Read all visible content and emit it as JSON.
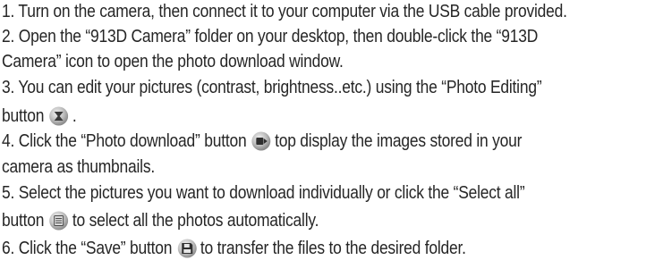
{
  "instructions": {
    "step1": "1. Turn on the camera, then connect it to your computer via the USB cable provided.",
    "step2_line1": "2. Open the “913D Camera” folder on your desktop, then double-click the “913D",
    "step2_line2": "Camera” icon to open the photo download window.",
    "step3_line1": "3. You can edit your pictures (contrast, brightness..etc.) using the “Photo Editing”",
    "step3_line2_before": "button",
    "step3_line2_after": ".",
    "step4_line1_before": "4. Click the “Photo download” button",
    "step4_line1_after": "top display the images stored in your",
    "step4_line2": "camera as thumbnails.",
    "step5_line1": "5. Select the pictures you want to download individually or click the “Select all”",
    "step5_line2_before": "button",
    "step5_line2_after": "to select all the photos automatically.",
    "step6_before": "6. Click the “Save” button",
    "step6_after": "to transfer the files to the desired folder."
  },
  "icons": {
    "photo_editing": "photo-editing-icon",
    "photo_download": "photo-download-icon",
    "select_all": "select-all-icon",
    "save": "save-icon"
  }
}
